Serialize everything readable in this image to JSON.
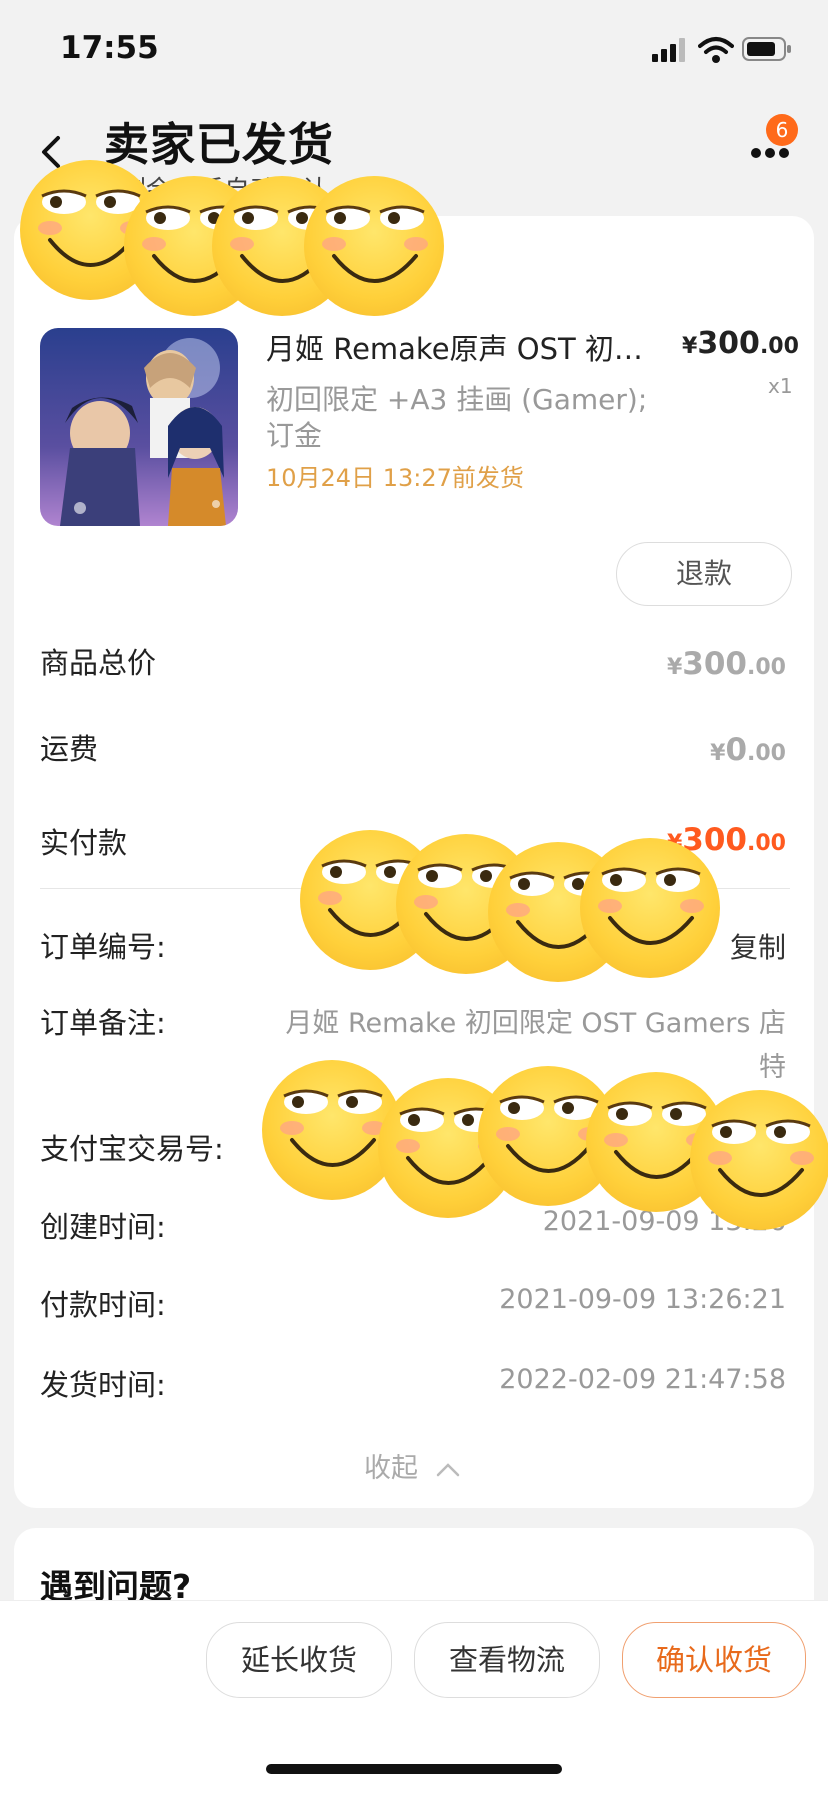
{
  "status_bar": {
    "time": "17:55"
  },
  "header": {
    "title": "卖家已发货",
    "subtitle": "剩余…后自动确认",
    "badge_count": "6"
  },
  "product": {
    "title": "月姬 Remake原声 OST 初…",
    "price_yen": "¥",
    "price_int": "300",
    "price_dec": ".00",
    "quantity": "x1",
    "spec": "初回限定 +A3 挂画 (Gamer); 订金",
    "ship_eta": "10月24日 13:27前发货",
    "refund_label": "退款"
  },
  "summary": {
    "total_label": "商品总价",
    "total_yen": "¥",
    "total_int": "300",
    "total_dec": ".00",
    "shipping_label": "运费",
    "shipping_yen": "¥",
    "shipping_int": "0",
    "shipping_dec": ".00",
    "paid_label": "实付款",
    "paid_yen": "¥",
    "paid_int": "300",
    "paid_dec": ".00"
  },
  "order": {
    "number_label": "订单编号:",
    "number_action": "复制",
    "note_label": "订单备注:",
    "note_value": "月姬 Remake 初回限定 OST Gamers 店特",
    "alipay_label": "支付宝交易号:",
    "created_label": "创建时间:",
    "created_value": "2021-09-09 13:26",
    "paid_time_label": "付款时间:",
    "paid_time_value": "2021-09-09 13:26:21",
    "shipped_label": "发货时间:",
    "shipped_value": "2022-02-09 21:47:58",
    "collapse_label": "收起"
  },
  "help": {
    "title": "遇到问题?"
  },
  "actions": {
    "extend": "延长收货",
    "logistics": "查看物流",
    "confirm": "确认收货"
  },
  "colors": {
    "accent_orange": "#ff5a1f",
    "eta_text": "#e0a048",
    "confirm_border": "#f0a070"
  },
  "icons": [
    "back-arrow-icon",
    "signal-icon",
    "wifi-icon",
    "battery-icon",
    "more-icon",
    "chevron-up-icon",
    "emoji-sticker-icon"
  ]
}
